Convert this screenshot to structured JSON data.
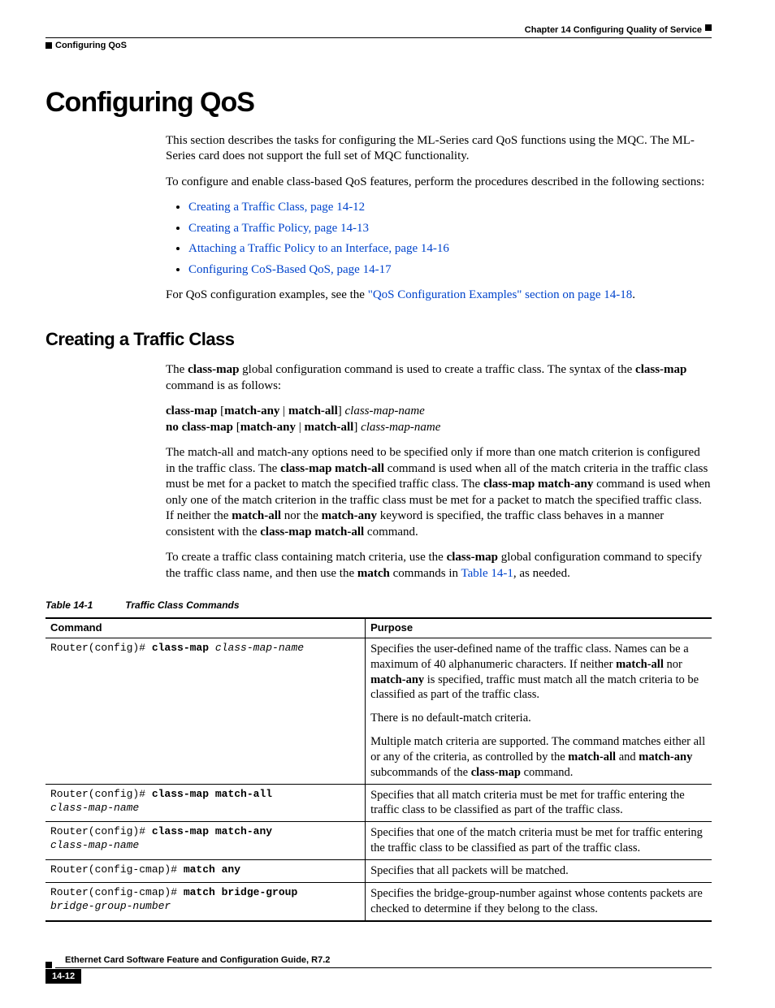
{
  "header": {
    "chapter": "Chapter 14    Configuring Quality of Service",
    "section": "Configuring QoS"
  },
  "h1": "Configuring QoS",
  "intro1": "This section describes the tasks for configuring the ML-Series card QoS functions using the MQC. The ML-Series card does not support the full set of MQC functionality.",
  "intro2": "To configure and enable class-based QoS features, perform the procedures described in the following sections:",
  "links": {
    "l1": "Creating a Traffic Class, page 14-12",
    "l2": "Creating a Traffic Policy, page 14-13",
    "l3": "Attaching a Traffic Policy to an Interface, page 14-16",
    "l4": "Configuring CoS-Based QoS, page 14-17"
  },
  "intro3a": "For QoS configuration examples, see the ",
  "intro3b": "\"QoS Configuration Examples\" section on page 14-18",
  "intro3c": ".",
  "h2": "Creating a Traffic Class",
  "p1a": "The ",
  "p1b": "class-map",
  "p1c": " global configuration command is used to create a traffic class. The syntax of the ",
  "p1d": "class-map",
  "p1e": " command is as follows:",
  "syntax": {
    "s1a": "class-map",
    "s1b": " [",
    "s1c": "match-any",
    "s1d": " | ",
    "s1e": "match-all",
    "s1f": "] ",
    "s1g": "class-map-name",
    "s2a": "no class-map",
    "s2b": " [",
    "s2c": "match-any",
    "s2d": " | ",
    "s2e": "match-all",
    "s2f": "] ",
    "s2g": "class-map-name"
  },
  "p2a": "The match-all and match-any options need to be specified only if more than one match criterion is configured in the traffic class. The ",
  "p2b": "class-map match-all",
  "p2c": " command is used when all of the match criteria in the traffic class must be met for a packet to match the specified traffic class. The ",
  "p2d": "class-map match-any",
  "p2e": " command is used when only one of the match criterion in the traffic class must be met for a packet to match the specified traffic class. If neither the ",
  "p2f": "match-all",
  "p2g": " nor the ",
  "p2h": "match-any",
  "p2i": " keyword is specified, the traffic class behaves in a manner consistent with the ",
  "p2j": "class-map match-all",
  "p2k": " command.",
  "p3a": "To create a traffic class containing match criteria, use the ",
  "p3b": "class-map",
  "p3c": " global configuration command to specify the traffic class name, and then use the ",
  "p3d": "match",
  "p3e": " commands in ",
  "p3f": "Table 14-1",
  "p3g": ", as needed.",
  "table_caption_num": "Table 14-1",
  "table_caption_title": "Traffic Class Commands",
  "th1": "Command",
  "th2": "Purpose",
  "rows": {
    "r1": {
      "prompt": "Router(config)# ",
      "cmd": "class-map",
      "arg": " class-map-name",
      "p1a": "Specifies the user-defined name of the traffic class. Names can be a maximum of 40 alphanumeric characters. If neither ",
      "p1b": "match-all",
      "p1c": " nor ",
      "p1d": "match-any",
      "p1e": " is specified, traffic must match all the match criteria to be classified as part of the traffic class.",
      "p2": "There is no default-match criteria.",
      "p3a": "Multiple match criteria are supported. The command matches either all or any of the criteria, as controlled by the ",
      "p3b": "match-all",
      "p3c": " and ",
      "p3d": "match-any",
      "p3e": " subcommands of the ",
      "p3f": "class-map",
      "p3g": " command."
    },
    "r2": {
      "prompt": "Router(config)# ",
      "cmd": "class-map match-all",
      "arg": "class-map-name",
      "purpose": "Specifies that all match criteria must be met for traffic entering the traffic class to be classified as part of the traffic class."
    },
    "r3": {
      "prompt": "Router(config)# ",
      "cmd": "class-map match-any",
      "arg": "class-map-name",
      "purpose": "Specifies that one of the match criteria must be met for traffic entering the traffic class to be classified as part of the traffic class."
    },
    "r4": {
      "prompt": "Router(config-cmap)# ",
      "cmd": "match any",
      "purpose": "Specifies that all packets will be matched."
    },
    "r5": {
      "prompt": "Router(config-cmap)# ",
      "cmd": "match bridge-group",
      "arg": "bridge-group-number",
      "purpose": "Specifies the bridge-group-number against whose contents packets are checked to determine if they belong to the class."
    }
  },
  "footer": {
    "title": "Ethernet Card Software Feature and Configuration Guide, R7.2",
    "page": "14-12"
  }
}
